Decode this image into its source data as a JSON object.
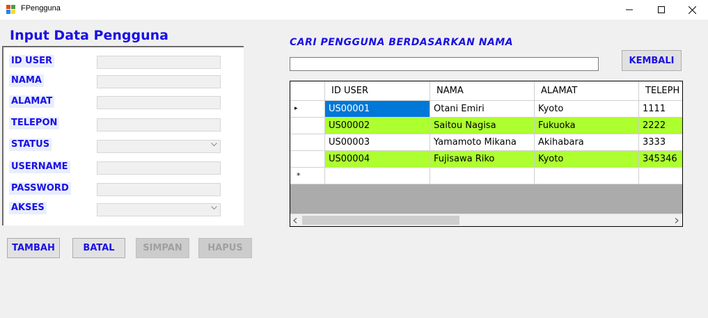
{
  "window": {
    "title": "FPengguna"
  },
  "form": {
    "title": "Input Data Pengguna",
    "fields": [
      {
        "label": "ID USER",
        "value": ""
      },
      {
        "label": "NAMA",
        "value": ""
      },
      {
        "label": "ALAMAT",
        "value": ""
      },
      {
        "label": "TELEPON",
        "value": ""
      },
      {
        "label": "STATUS",
        "value": ""
      },
      {
        "label": "USERNAME",
        "value": ""
      },
      {
        "label": "PASSWORD",
        "value": ""
      },
      {
        "label": "AKSES",
        "value": ""
      }
    ],
    "buttons": {
      "tambah": "TAMBAH",
      "batal": "BATAL",
      "simpan": "SIMPAN",
      "hapus": "HAPUS"
    }
  },
  "search": {
    "title": "CARI PENGGUNA BERDASARKAN NAMA",
    "value": "",
    "back_label": "KEMBALI"
  },
  "grid": {
    "columns": [
      "ID USER",
      "NAMA",
      "ALAMAT",
      "TELEPH"
    ],
    "rows": [
      {
        "id": "US00001",
        "nama": "Otani Emiri",
        "alamat": "Kyoto",
        "telepon": "1111",
        "highlight": "selected"
      },
      {
        "id": "US00002",
        "nama": "Saitou Nagisa",
        "alamat": "Fukuoka",
        "telepon": "2222",
        "highlight": "green"
      },
      {
        "id": "US00003",
        "nama": "Yamamoto Mikana",
        "alamat": "Akihabara",
        "telepon": "3333",
        "highlight": "none"
      },
      {
        "id": "US00004",
        "nama": "Fujisawa Riko",
        "alamat": "Kyoto",
        "telepon": "345346",
        "highlight": "green"
      }
    ],
    "current_row_marker": "▸",
    "new_row_marker": "*"
  },
  "colors": {
    "accent": "#1a10e6",
    "row_green": "#adff2f",
    "selected": "#0078d7",
    "grid_bg": "#ababab"
  }
}
